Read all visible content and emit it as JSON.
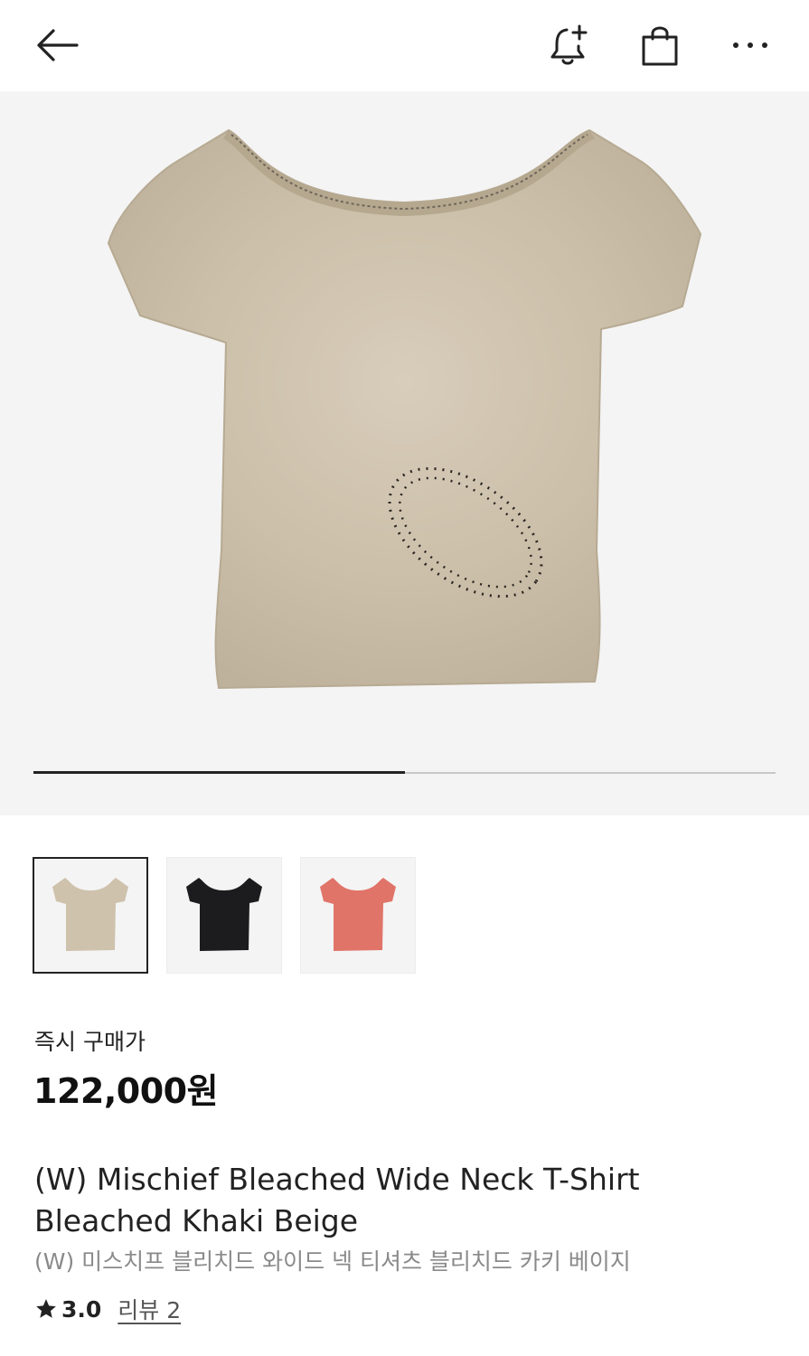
{
  "header": {
    "back_icon": "arrow-left-icon",
    "notify_icon": "bell-plus-icon",
    "cart_icon": "shopping-bag-icon",
    "more_icon": "more-horizontal-icon"
  },
  "gallery": {
    "progress": 0.5,
    "thumbnails": [
      {
        "color": "#cfc2ad",
        "selected": true
      },
      {
        "color": "#1c1c1e",
        "selected": false
      },
      {
        "color": "#e07468",
        "selected": false
      }
    ]
  },
  "price": {
    "label": "즉시 구매가",
    "value": "122,000원"
  },
  "product": {
    "title": "(W) Mischief Bleached Wide Neck T-Shirt Bleached Khaki Beige",
    "subtitle": "(W) 미스치프 블리치드 와이드 넥 티셔츠 블리치드 카키 베이지"
  },
  "rating": {
    "star_icon": "star-icon",
    "score": "3.0",
    "review_label": "리뷰 2"
  }
}
